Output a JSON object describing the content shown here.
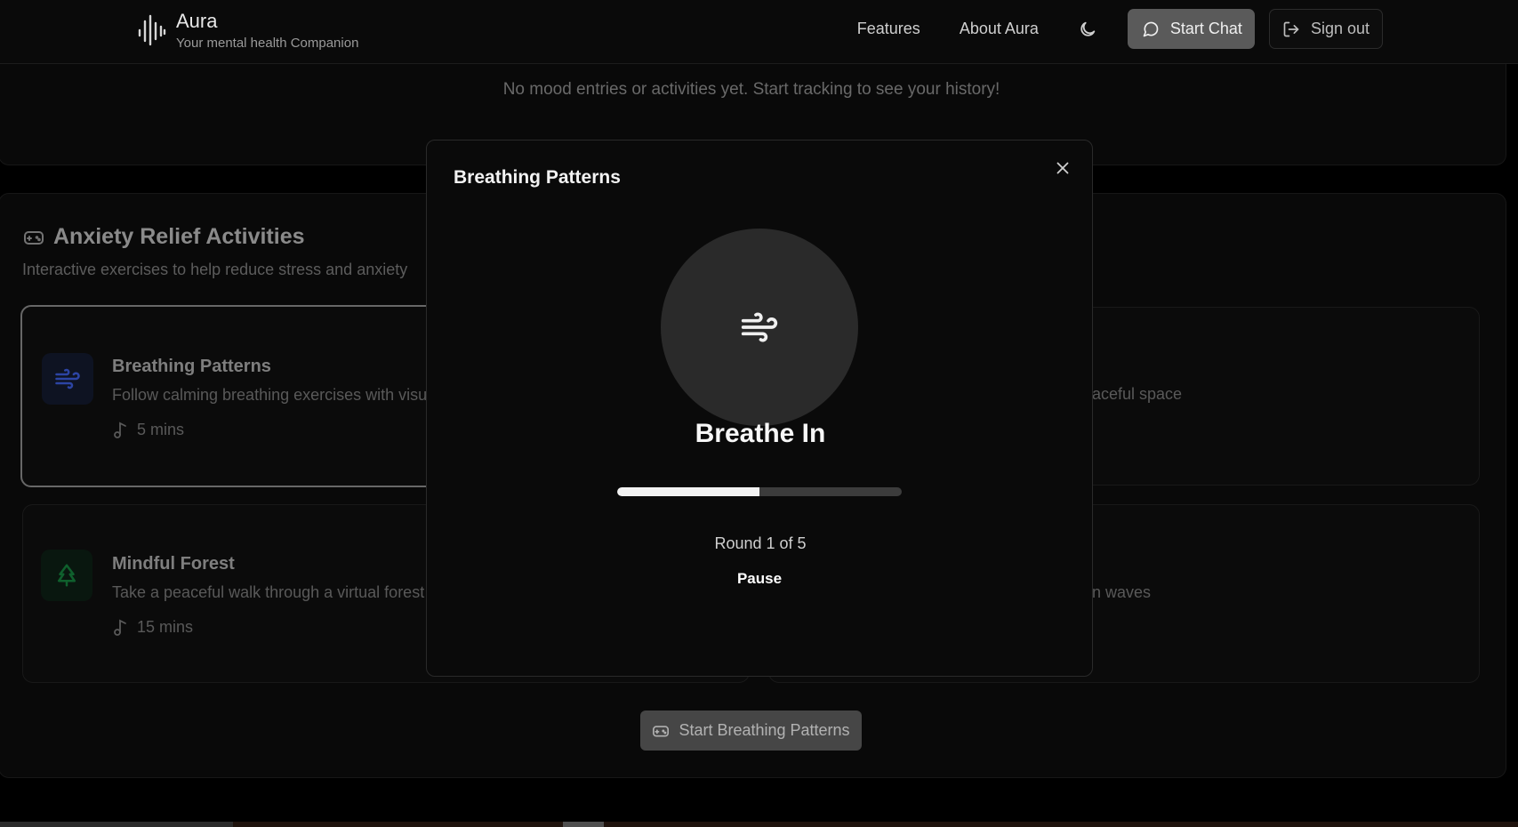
{
  "header": {
    "app_name": "Aura",
    "tagline": "Your mental health Companion",
    "nav": {
      "features": "Features",
      "about": "About Aura"
    },
    "start_chat": "Start Chat",
    "sign_out": "Sign out"
  },
  "history": {
    "empty_message": "No mood entries or activities yet. Start tracking to see your history!"
  },
  "activities": {
    "title": "Anxiety Relief Activities",
    "subtitle": "Interactive exercises to help reduce stress and anxiety",
    "items": [
      {
        "name": "Breathing Patterns",
        "description": "Follow calming breathing exercises with visual",
        "duration": "5 mins",
        "icon": "wind-icon",
        "accent": "#3b5bdb"
      },
      {
        "name": "",
        "description": "aceful space",
        "duration": "",
        "icon": "",
        "accent": ""
      },
      {
        "name": "Mindful Forest",
        "description": "Take a peaceful walk through a virtual forest",
        "duration": "15 mins",
        "icon": "tree-icon",
        "accent": "#15803d"
      },
      {
        "name": "",
        "description": "n waves",
        "duration": "",
        "icon": "",
        "accent": ""
      }
    ],
    "start_button": "Start Breathing Patterns"
  },
  "modal": {
    "title": "Breathing Patterns",
    "phase": "Breathe In",
    "progress_fraction": 0.5,
    "round_text": "Round 1 of 5",
    "pause_label": "Pause"
  },
  "icons": {
    "logo": "waveform-icon",
    "theme": "moon-icon",
    "chat": "message-circle-icon",
    "signout": "log-out-icon",
    "gamepad": "gamepad-icon",
    "duration": "music-note-icon",
    "close": "close-icon",
    "breath": "wind-icon"
  }
}
